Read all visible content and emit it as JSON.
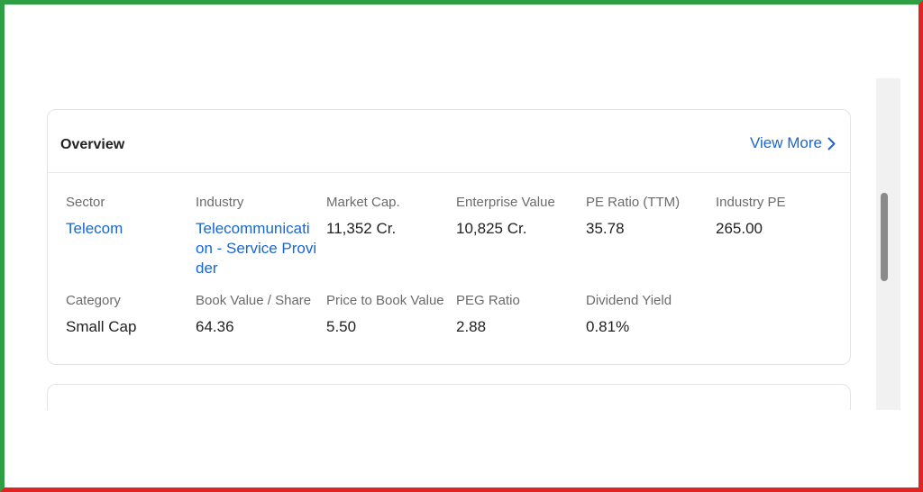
{
  "overview": {
    "title": "Overview",
    "view_more_label": "View More",
    "metrics": [
      {
        "label": "Sector",
        "value": "Telecom",
        "link": true
      },
      {
        "label": "Industry",
        "value": "Telecommunication - Service Provider",
        "link": true
      },
      {
        "label": "Market Cap.",
        "value": "11,352 Cr."
      },
      {
        "label": "Enterprise Value",
        "value": "10,825 Cr."
      },
      {
        "label": "PE Ratio (TTM)",
        "value": "35.78"
      },
      {
        "label": "Industry PE",
        "value": "265.00"
      },
      {
        "label": "Category",
        "value": "Small Cap"
      },
      {
        "label": "Book Value / Share",
        "value": "64.36"
      },
      {
        "label": "Price to Book Value",
        "value": "5.50"
      },
      {
        "label": "PEG Ratio",
        "value": "2.88"
      },
      {
        "label": "Dividend Yield",
        "value": "0.81%"
      }
    ]
  },
  "colors": {
    "link": "#1a66d2",
    "frame_left_top": "#2ea043",
    "frame_right_bottom": "#e02424"
  }
}
